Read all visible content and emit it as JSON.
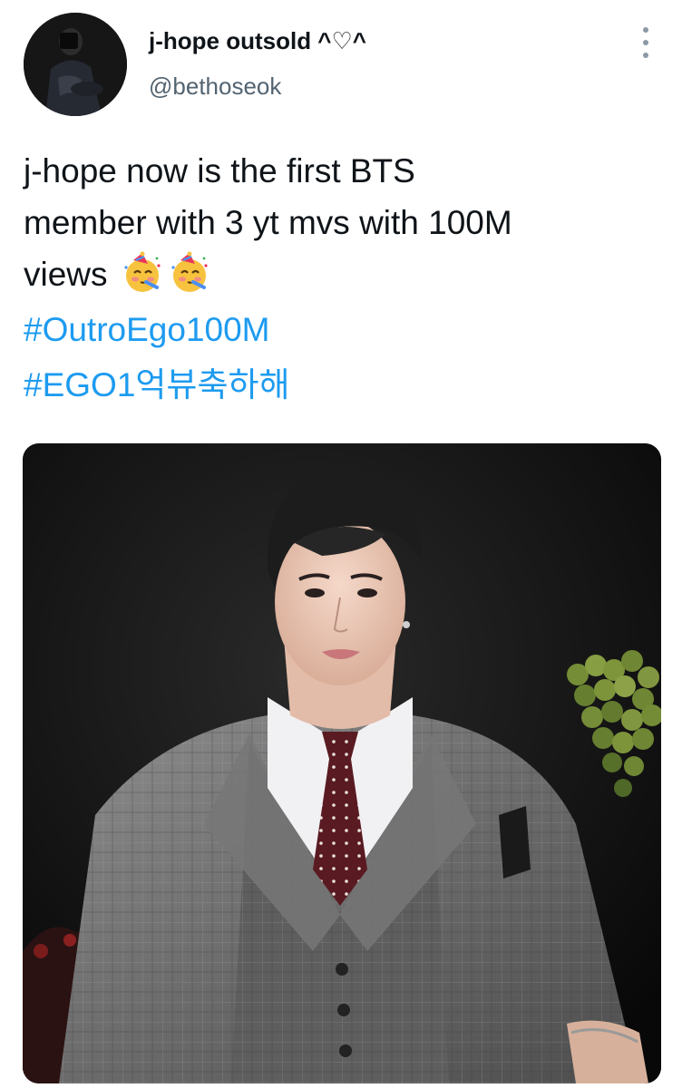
{
  "author": {
    "display_name": "j-hope outsold ^♡^",
    "handle": "@bethoseok",
    "avatar_icon": "profile-photo"
  },
  "menu": {
    "icon": "more-vertical-icon"
  },
  "tweet": {
    "text_lines": [
      "j-hope now is the first BTS",
      "member with 3 yt mvs with 100M",
      "views"
    ],
    "emojis": [
      "partying-face",
      "partying-face"
    ],
    "hashtags": [
      "#OutroEgo100M",
      "#EGO1억뷰축하해"
    ]
  },
  "media": {
    "type": "photo",
    "description": "photo of a person in a gray plaid three-piece suit with a dark red patterned tie against a dark background with green grapes"
  },
  "colors": {
    "hashtag": "#1d9bf0",
    "text": "#0f1419",
    "secondary": "#536471"
  }
}
